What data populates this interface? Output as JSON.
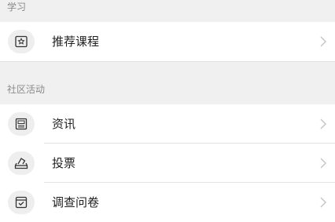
{
  "sections": [
    {
      "title": "学习",
      "items": [
        {
          "label": "推荐课程",
          "icon": "star-in-square-icon"
        }
      ]
    },
    {
      "title": "社区活动",
      "items": [
        {
          "label": "资讯",
          "icon": "news-icon"
        },
        {
          "label": "投票",
          "icon": "ballot-box-icon"
        },
        {
          "label": "调查问卷",
          "icon": "survey-icon"
        }
      ]
    }
  ],
  "colors": {
    "background": "#f0f0f0",
    "item_background": "#ffffff",
    "header_text": "#8a8a8a",
    "item_text": "#1f1f1f",
    "icon_background": "#eeeeee",
    "chevron": "#c4c4c4"
  }
}
